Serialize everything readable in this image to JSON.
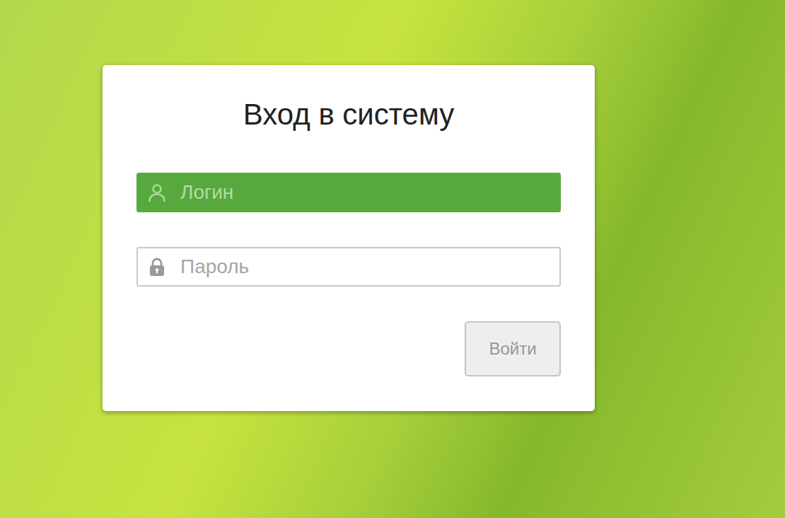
{
  "window": {
    "title": "Вход в систему"
  },
  "fields": [
    {
      "kind": "login",
      "placeholder": "Логин",
      "focused": true
    },
    {
      "kind": "password",
      "placeholder": "Пароль",
      "focused": false
    }
  ],
  "buttons": [
    {
      "label": "Войти",
      "disabled": true
    }
  ]
}
